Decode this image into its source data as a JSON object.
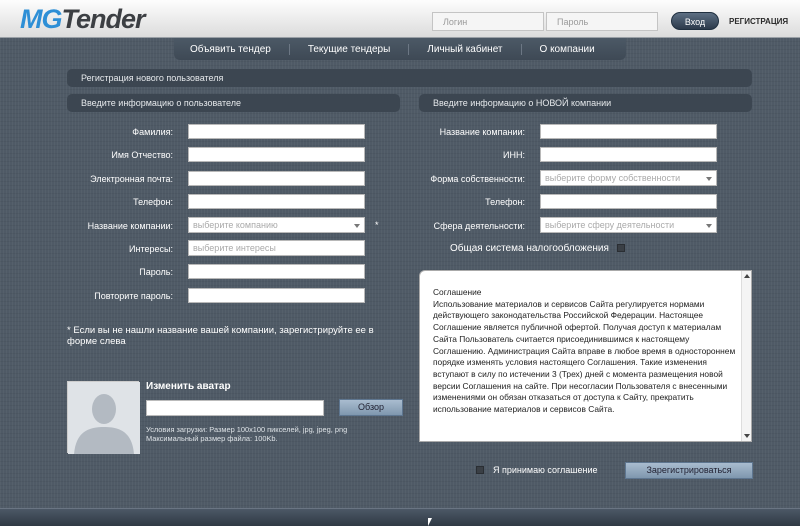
{
  "header": {
    "logo_mg": "MG",
    "logo_tender": "Tender",
    "login_placeholder": "Логин",
    "password_placeholder": "Пароль",
    "login_button": "Вход",
    "register_link": "РЕГИСТРАЦИЯ"
  },
  "nav": {
    "items": [
      {
        "label": "Объявить тендер"
      },
      {
        "label": "Текущие тендеры"
      },
      {
        "label": "Личный кабинет"
      },
      {
        "label": "О компании"
      }
    ]
  },
  "page_title": "Регистрация нового пользователя",
  "user_section": {
    "title": "Введите информацию о пользователе",
    "fields": {
      "last_name": "Фамилия:",
      "first_middle_name": "Имя Отчество:",
      "email": "Электронная почта:",
      "phone": "Телефон:",
      "company_name": "Название компании:",
      "company_placeholder": "выберите компанию",
      "interests": "Интересы:",
      "interests_placeholder": "выберите интересы",
      "password": "Пароль:",
      "repeat_password": "Повторите пароль:"
    },
    "asterisk": "*",
    "note": "* Если вы не нашли название вашей компании, зарегистрируйте ее в форме слева"
  },
  "company_section": {
    "title": "Введите информацию о НОВОЙ компании",
    "fields": {
      "company_name": "Название компании:",
      "inn": "ИНН:",
      "ownership_form": "Форма собственности:",
      "ownership_placeholder": "выберите форму собственности",
      "phone": "Телефон:",
      "activity": "Сфера деятельности:",
      "activity_placeholder": "выберите сферу деятельности",
      "tax_system": "Общая система налогообложения"
    }
  },
  "agreement": {
    "title": "Соглашение",
    "text": "Использование материалов и сервисов Сайта регулируется нормами действующего законодательства Российской Федерации. Настоящее Соглашение является публичной офертой. Получая доступ к материалам Сайта Пользователь считается присоединившимся к настоящему Соглашению. Администрация Сайта вправе в любое время в одностороннем порядке изменять условия настоящего Соглашения. Такие изменения вступают в силу по истечении 3 (Трех) дней с момента размещения новой версии Соглашения на сайте. При несогласии Пользователя с внесенными изменениями он обязан отказаться от доступа к Сайту, прекратить использование материалов и сервисов Сайта.",
    "accept_label": "Я принимаю соглашение",
    "submit_button": "Зарегистрироваться"
  },
  "avatar": {
    "title": "Изменить аватар",
    "browse_button": "Обзор",
    "upload_info_1": "Условия загрузки: Размер 100x100 пикселей, jpg, jpeg, png",
    "upload_info_2": "Максимальный размер файла: 100Kb."
  },
  "colors": {
    "background": "#4f5a66",
    "bar": "#3c4651",
    "logo_accent": "#2e8fd6",
    "button": "#8fa6bd"
  }
}
